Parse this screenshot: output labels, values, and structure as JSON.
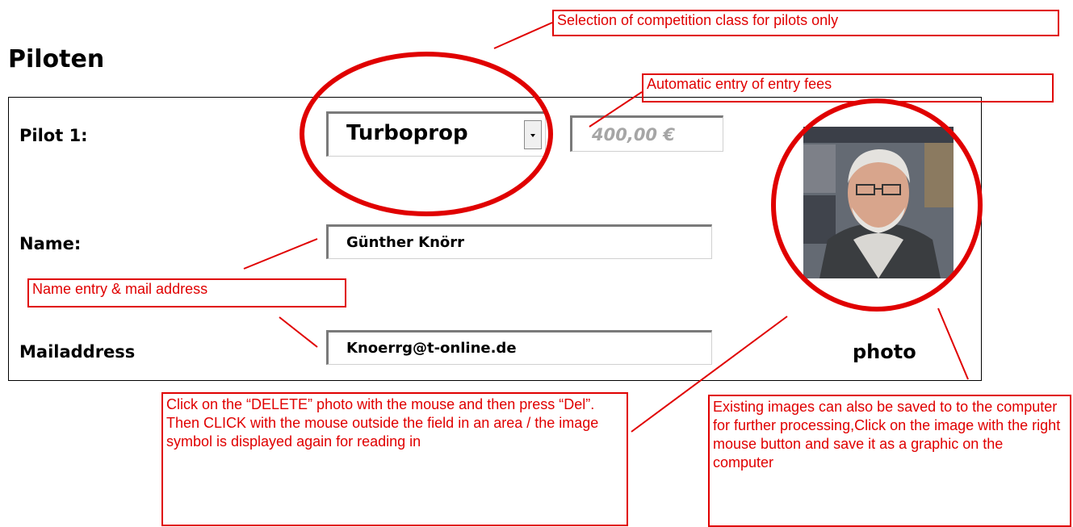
{
  "page": {
    "title": "Piloten",
    "pilot_label": "Pilot 1:",
    "name_label": "Name:",
    "mail_label": "Mailaddress",
    "photo_label": "photo"
  },
  "class_select": {
    "value": "Turboprop"
  },
  "fee_field": {
    "value": "400,00 €"
  },
  "name_field": {
    "value": "Günther Knörr"
  },
  "mail_field": {
    "value": "Knoerrg@t-online.de"
  },
  "annotations": {
    "class_note": "Selection of competition class for pilots only",
    "fee_note": "Automatic entry of entry fees",
    "name_note": "Name entry & mail address",
    "delete_note": "Click on the “DELETE” photo with the mouse and then press “Del”. Then CLICK with the mouse outside the field in an area / the image symbol is displayed again for reading in",
    "save_note": "Existing images can also be saved to to the computer for further processing,Click on the image with the right mouse button and save it as a graphic on the computer"
  },
  "colors": {
    "annotation": "#e00000",
    "fee_text": "#a6a6a6"
  }
}
